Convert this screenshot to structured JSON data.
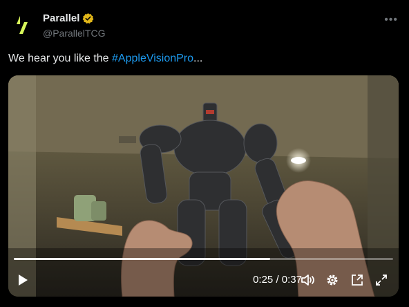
{
  "tweet": {
    "display_name": "Parallel",
    "handle": "@ParallelTCG",
    "text_prefix": "We hear you like the ",
    "hashtag": "#AppleVisionPro",
    "text_suffix": "..."
  },
  "video": {
    "current_time": "0:25",
    "duration": "0:37",
    "time_separator": " / ",
    "progress": 0.676
  },
  "colors": {
    "background": "#000000",
    "text": "#e7e9ea",
    "muted": "#71767b",
    "link": "#1d9bf0",
    "verified_badge": "#e2b719",
    "logo_accent": "#d7f55a"
  },
  "icons": {
    "avatar": "parallel-logo-icon",
    "badge": "verified-badge-icon",
    "more": "more-icon",
    "play": "play-icon",
    "volume": "volume-icon",
    "settings": "settings-icon",
    "pip": "picture-in-picture-icon",
    "fullscreen": "fullscreen-icon"
  }
}
